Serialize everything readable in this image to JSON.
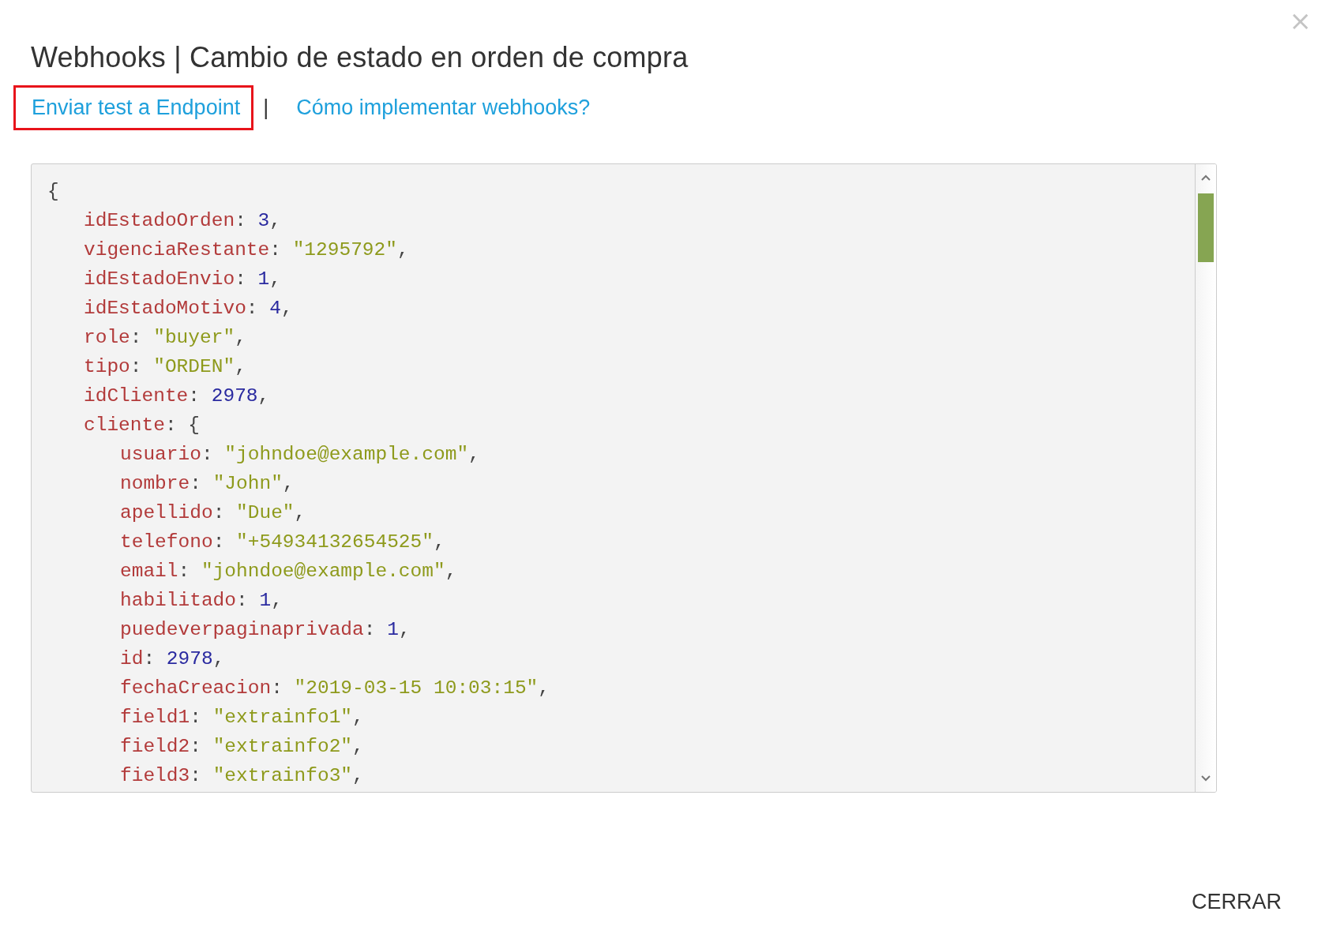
{
  "dialog": {
    "close": "×",
    "title": "Webhooks | Cambio de estado en orden de compra",
    "links": [
      {
        "label": "Enviar test a Endpoint",
        "highlighted": true
      },
      {
        "label": "Cómo implementar webhooks?",
        "highlighted": false
      }
    ],
    "separator": "|",
    "code": {
      "open": "{",
      "fields": [
        {
          "text": "idEstadoOrden: 3,",
          "kind": "number"
        },
        {
          "text": "vigenciaRestante: \"1295792\",",
          "kind": "string"
        },
        {
          "text": "idEstadoEnvio: 1,",
          "kind": "number"
        },
        {
          "text": "idEstadoMotivo: 4,",
          "kind": "number"
        },
        {
          "text": "role: \"buyer\",",
          "kind": "string"
        },
        {
          "text": "tipo: \"ORDEN\",",
          "kind": "string"
        },
        {
          "text": "idCliente: 2978,",
          "kind": "number"
        },
        {
          "text": "cliente: {",
          "kind": "object",
          "children": [
            {
              "text": "usuario: \"johndoe@example.com\",",
              "kind": "string"
            },
            {
              "text": "nombre: \"John\",",
              "kind": "string"
            },
            {
              "text": "apellido: \"Due\",",
              "kind": "string"
            },
            {
              "text": "telefono: \"+54934132654525\",",
              "kind": "string"
            },
            {
              "text": "email: \"johndoe@example.com\",",
              "kind": "string"
            },
            {
              "text": "habilitado: 1,",
              "kind": "number"
            },
            {
              "text": "puedeverpaginaprivada: 1,",
              "kind": "number"
            },
            {
              "text": "id: 2978,",
              "kind": "number"
            },
            {
              "text": "fechaCreacion: \"2019-03-15 10:03:15\",",
              "kind": "string"
            },
            {
              "text": "field1: \"extrainfo1\",",
              "kind": "string"
            },
            {
              "text": "field2: \"extrainfo2\",",
              "kind": "string"
            },
            {
              "text": "field3: \"extrainfo3\",",
              "kind": "string"
            }
          ]
        }
      ]
    },
    "close_button": "CERRAR"
  }
}
